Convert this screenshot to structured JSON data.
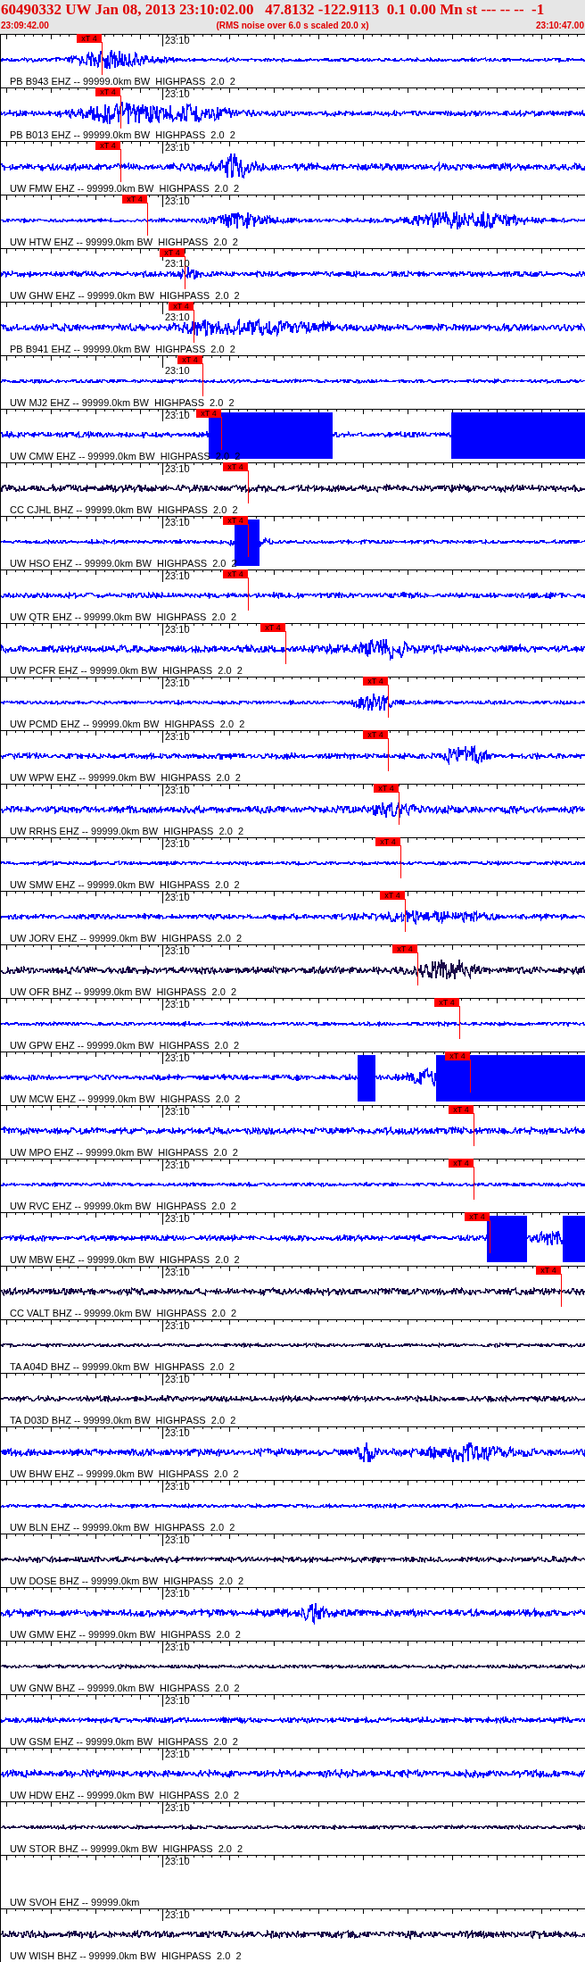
{
  "header": {
    "title": "60490332 UW Jan 08, 2013 23:10:02.00   47.8132 -122.9113  0.1 0.00 Mn st --- -- --  -1",
    "start_time": "23:09:42.00",
    "note": "(RMS noise over 6.0 s scaled 20.0 x)",
    "end_time": "23:10:47.00"
  },
  "traces": [
    {
      "kind": "waveform",
      "color": "#0000ff",
      "time_label": "23:10",
      "pick": "xT 4",
      "label": "PB B943 EHZ -- 99999.0km BW  HIGHPASS  2.0  2"
    },
    {
      "kind": "waveform",
      "color": "#0000ff",
      "time_label": "23:10",
      "pick": "xT 4",
      "label": "PB B013 EHZ -- 99999.0km BW  HIGHPASS  2.0  2"
    },
    {
      "kind": "waveform",
      "color": "#0000ff",
      "time_label": "23:10",
      "pick": "xT 4",
      "label": "UW FMW EHZ -- 99999.0km BW  HIGHPASS  2.0  2"
    },
    {
      "kind": "waveform",
      "color": "#0000ff",
      "time_label": "23:10",
      "pick": "xT 4",
      "label": "UW HTW EHZ -- 99999.0km BW  HIGHPASS  2.0  2"
    },
    {
      "kind": "waveform",
      "color": "#0000ff",
      "time_label": "23:10",
      "pick": "xT 4",
      "label": "UW GHW EHZ -- 99999.0km BW  HIGHPASS  2.0  2"
    },
    {
      "kind": "waveform",
      "color": "#0000ff",
      "time_label": "23:10",
      "pick": "xT 4",
      "label": "PB B941 EHZ -- 99999.0km BW  HIGHPASS  2.0  2"
    },
    {
      "kind": "waveform",
      "color": "#0000ff",
      "time_label": "23:10",
      "pick": "xT 4",
      "label": "UW MJ2 EHZ -- 99999.0km BW  HIGHPASS  2.0  2"
    },
    {
      "kind": "waveform",
      "color": "#0000ff",
      "time_label": "23:10",
      "pick": "xT 4",
      "label": "UW CMW EHZ -- 99999.0km BW  HIGHPASS  2.0  2"
    },
    {
      "kind": "waveform",
      "color": "#1a0a4a",
      "time_label": "23:10",
      "pick": "xT 4",
      "label": "CC CJHL BHZ -- 99999.0km BW  HIGHPASS  2.0  2"
    },
    {
      "kind": "waveform",
      "color": "#0000ff",
      "time_label": "23:10",
      "pick": "xT 4",
      "label": "UW HSO EHZ -- 99999.0km BW  HIGHPASS  2.0  2"
    },
    {
      "kind": "waveform",
      "color": "#0000ff",
      "time_label": "23:10",
      "pick": "xT 4",
      "label": "UW QTR EHZ -- 99999.0km BW  HIGHPASS  2.0  2"
    },
    {
      "kind": "waveform",
      "color": "#0000ff",
      "time_label": "23:10",
      "pick": "xT 4",
      "label": "UW PCFR EHZ -- 99999.0km BW  HIGHPASS  2.0  2"
    },
    {
      "kind": "waveform",
      "color": "#0000ff",
      "time_label": "23:10",
      "pick": "xT 4",
      "label": "UW PCMD EHZ -- 99999.0km BW  HIGHPASS  2.0  2"
    },
    {
      "kind": "waveform",
      "color": "#0000ff",
      "time_label": "23:10",
      "pick": "xT 4",
      "label": "UW WPW EHZ -- 99999.0km BW  HIGHPASS  2.0  2"
    },
    {
      "kind": "waveform",
      "color": "#0000ff",
      "time_label": "23:10",
      "pick": "xT 4",
      "label": "UW RRHS EHZ -- 99999.0km BW  HIGHPASS  2.0  2"
    },
    {
      "kind": "waveform",
      "color": "#0000ff",
      "time_label": "23:10",
      "pick": "xT 4",
      "label": "UW SMW EHZ -- 99999.0km BW  HIGHPASS  2.0  2"
    },
    {
      "kind": "waveform",
      "color": "#0000ff",
      "time_label": "23:10",
      "pick": "xT 4",
      "label": "UW JORV EHZ -- 99999.0km BW  HIGHPASS  2.0  2"
    },
    {
      "kind": "waveform",
      "color": "#1a0a4a",
      "time_label": "23:10",
      "pick": "xT 4",
      "label": "UW OFR BHZ -- 99999.0km BW  HIGHPASS  2.0  2"
    },
    {
      "kind": "waveform",
      "color": "#0000ff",
      "time_label": "23:10",
      "pick": "xT 4",
      "label": "UW GPW EHZ -- 99999.0km BW  HIGHPASS  2.0  2"
    },
    {
      "kind": "waveform",
      "color": "#0000ff",
      "time_label": "23:10",
      "pick": "xT 4",
      "label": "UW MCW EHZ -- 99999.0km BW  HIGHPASS  2.0  2"
    },
    {
      "kind": "waveform",
      "color": "#0000ff",
      "time_label": "23:10",
      "pick": "xT 4",
      "label": "UW MPO EHZ -- 99999.0km BW  HIGHPASS  2.0  2"
    },
    {
      "kind": "waveform",
      "color": "#0000ff",
      "time_label": "23:10",
      "pick": "xT 4",
      "label": "UW RVC EHZ -- 99999.0km BW  HIGHPASS  2.0  2"
    },
    {
      "kind": "waveform",
      "color": "#0000ff",
      "time_label": "23:10",
      "pick": "xT 4",
      "label": "UW MBW EHZ -- 99999.0km BW  HIGHPASS  2.0  2"
    },
    {
      "kind": "waveform",
      "color": "#1a0a4a",
      "time_label": "23:10",
      "pick": "xT 4",
      "label": "CC VALT BHZ -- 99999.0km BW  HIGHPASS  2.0  2"
    },
    {
      "kind": "waveform",
      "color": "#1a0a4a",
      "time_label": "23:10",
      "label": "TA A04D BHZ -- 99999.0km BW  HIGHPASS  2.0  2"
    },
    {
      "kind": "waveform",
      "color": "#1a0a4a",
      "time_label": "23:10",
      "label": "TA D03D BHZ -- 99999.0km BW  HIGHPASS  2.0  2"
    },
    {
      "kind": "waveform",
      "color": "#0000ff",
      "time_label": "23:10",
      "label": "UW BHW EHZ -- 99999.0km BW  HIGHPASS  2.0  2"
    },
    {
      "kind": "waveform",
      "color": "#0000ff",
      "time_label": "23:10",
      "label": "UW BLN EHZ -- 99999.0km BW  HIGHPASS  2.0  2"
    },
    {
      "kind": "waveform",
      "color": "#1a0a4a",
      "time_label": "23:10",
      "label": "UW DOSE BHZ -- 99999.0km BW  HIGHPASS  2.0  2"
    },
    {
      "kind": "waveform",
      "color": "#0000ff",
      "time_label": "23:10",
      "label": "UW GMW EHZ -- 99999.0km BW  HIGHPASS  2.0  2"
    },
    {
      "kind": "waveform",
      "color": "#1a0a4a",
      "time_label": "23:10",
      "label": "UW GNW BHZ -- 99999.0km BW  HIGHPASS  2.0  2"
    },
    {
      "kind": "waveform",
      "color": "#0000ff",
      "time_label": "23:10",
      "label": "UW GSM EHZ -- 99999.0km BW  HIGHPASS  2.0  2"
    },
    {
      "kind": "waveform",
      "color": "#0000ff",
      "time_label": "23:10",
      "label": "UW HDW EHZ -- 99999.0km BW  HIGHPASS  2.0  2"
    },
    {
      "kind": "waveform",
      "color": "#1a0a4a",
      "time_label": "23:10",
      "label": "UW STOR BHZ -- 99999.0km BW  HIGHPASS  2.0  2"
    },
    {
      "kind": "blank",
      "time_label": "23:10",
      "label": "UW SVOH EHZ -- 99999.0km"
    },
    {
      "kind": "waveform",
      "color": "#1a0a4a",
      "time_label": "23:10",
      "label": "UW WISH BHZ -- 99999.0km BW  HIGHPASS  2.0  2"
    }
  ]
}
